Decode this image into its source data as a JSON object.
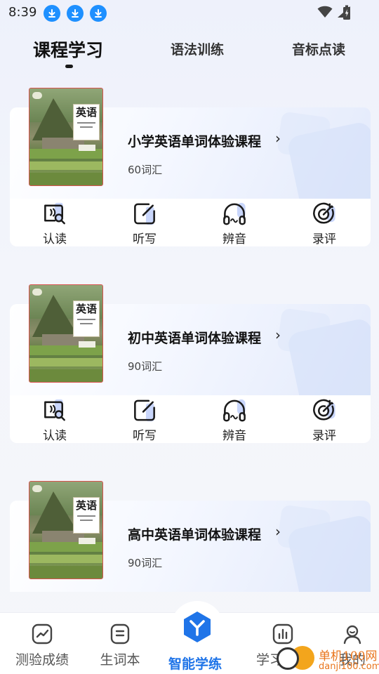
{
  "status_bar": {
    "time": "8:39"
  },
  "tabs": [
    {
      "label": "课程学习",
      "active": true
    },
    {
      "label": "语法训练",
      "active": false
    },
    {
      "label": "音标点读",
      "active": false
    }
  ],
  "book_cover": {
    "title": "英语"
  },
  "courses": [
    {
      "title": "小学英语单词体验课程",
      "count": "60词汇"
    },
    {
      "title": "初中英语单词体验课程",
      "count": "90词汇"
    },
    {
      "title": "高中英语单词体验课程",
      "count": "90词汇"
    }
  ],
  "actions": [
    {
      "label": "认读",
      "icon": "read-icon"
    },
    {
      "label": "听写",
      "icon": "dictation-icon"
    },
    {
      "label": "辨音",
      "icon": "headphones-icon"
    },
    {
      "label": "录评",
      "icon": "record-target-icon"
    }
  ],
  "arrow": "›",
  "bottom_nav": [
    {
      "label": "测验成绩",
      "icon": "chart-line-icon"
    },
    {
      "label": "生词本",
      "icon": "notebook-icon"
    },
    {
      "label": "智能学练",
      "icon": "smart-practice-icon",
      "active": true
    },
    {
      "label": "学习数据",
      "icon": "bar-chart-icon"
    },
    {
      "label": "我的",
      "icon": "profile-icon"
    }
  ],
  "watermark": {
    "line1": "单机100网",
    "line2": "danji100.com"
  },
  "colors": {
    "accent": "#1f74e8",
    "icon_accent": "#c9d6fb",
    "download": "#1e90ff"
  }
}
